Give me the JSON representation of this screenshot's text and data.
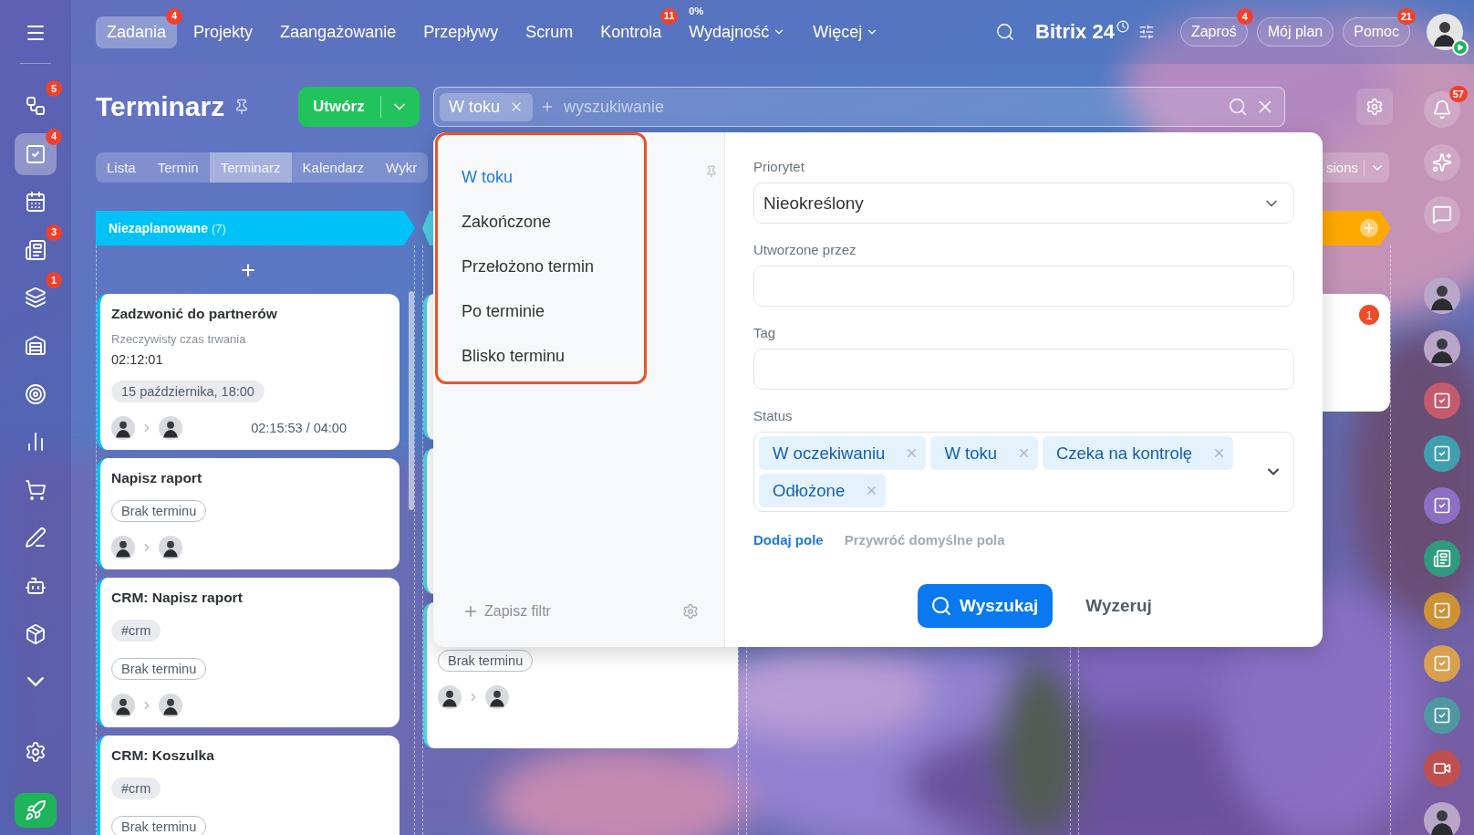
{
  "top_nav": {
    "items": [
      {
        "label": "Zadania",
        "selected": true,
        "badge": "4",
        "dropdown": false
      },
      {
        "label": "Projekty",
        "selected": false,
        "dropdown": false
      },
      {
        "label": "Zaangażowanie",
        "selected": false,
        "dropdown": false
      },
      {
        "label": "Przepływy",
        "selected": false,
        "dropdown": false
      },
      {
        "label": "Scrum",
        "selected": false,
        "dropdown": false
      },
      {
        "label": "Kontrola",
        "selected": false,
        "badge": "11",
        "dropdown": false
      },
      {
        "label": "Wydajność",
        "selected": false,
        "caption": "0%",
        "dropdown": true
      },
      {
        "label": "Więcej",
        "selected": false,
        "dropdown": true
      }
    ],
    "logo": "Bitrix 24",
    "pills": [
      {
        "label": "Zaproś",
        "badge": "4"
      },
      {
        "label": "Mój plan"
      },
      {
        "label": "Pomoc",
        "badge": "21"
      }
    ]
  },
  "sidebar": {
    "items": [
      {
        "selected": false
      },
      {
        "selected": false,
        "badge": "5"
      },
      {
        "selected": true,
        "badge": "4"
      },
      {
        "selected": false
      },
      {
        "selected": false,
        "badge": "3"
      },
      {
        "selected": false,
        "badge": "1"
      },
      {
        "selected": false
      },
      {
        "selected": false
      },
      {
        "selected": false
      },
      {
        "selected": false
      },
      {
        "selected": false
      },
      {
        "selected": false
      },
      {
        "selected": false
      },
      {
        "selected": false
      },
      {
        "selected": false
      },
      {
        "selected": false
      }
    ]
  },
  "header": {
    "title": "Terminarz",
    "create_button": "Utwórz",
    "search": {
      "chips": [
        "W toku"
      ],
      "placeholder": "wyszukiwanie"
    }
  },
  "view_tabs": {
    "items": [
      {
        "label": "Lista",
        "selected": false
      },
      {
        "label": "Termin",
        "selected": false
      },
      {
        "label": "Terminarz",
        "selected": true
      },
      {
        "label": "Kalendarz",
        "selected": false
      },
      {
        "label": "Wykr",
        "selected": false
      }
    ],
    "right_tab": "sions"
  },
  "columns": [
    {
      "kind": "stage",
      "title": "Niezaplanowane",
      "count": "(7)",
      "color": "#00c2f7",
      "cards": [
        {
          "title": "Zadzwonić do partnerów",
          "subtitle": "Rzeczywisty czas trwania",
          "time": "02:12:01",
          "tags": [
            {
              "text": "15 października, 18:00",
              "kind": "date"
            }
          ],
          "avatars": true,
          "elapsed": "02:15:53 / 04:00"
        },
        {
          "title": "Napisz raport",
          "tags": [
            {
              "text": "Brak terminu",
              "kind": "deadline"
            }
          ],
          "avatars": true
        },
        {
          "title": "CRM: Napisz raport",
          "tags": [
            {
              "text": "#crm",
              "kind": "hashtag"
            },
            {
              "text": "Brak terminu",
              "kind": "deadline"
            }
          ],
          "avatars": true
        },
        {
          "title": "CRM: Koszulka",
          "tags": [
            {
              "text": "#crm",
              "kind": "hashtag"
            },
            {
              "text": "Brak terminu",
              "kind": "deadline"
            }
          ],
          "avatars": false
        }
      ]
    },
    {
      "kind": "stage",
      "color": "#4fd0e4",
      "cards": [
        {
          "avatars": false
        },
        {
          "avatars": false
        },
        {
          "tags": [
            {
              "text": "Brak terminu",
              "kind": "deadline"
            }
          ],
          "avatars": true
        }
      ]
    },
    {
      "kind": "empty"
    },
    {
      "kind": "stage",
      "color": "#ffa900",
      "cards": [
        {
          "badge": "1"
        }
      ]
    }
  ],
  "filter_popup": {
    "presets": [
      {
        "label": "W toku",
        "selected": true
      },
      {
        "label": "Zakończone",
        "selected": false
      },
      {
        "label": "Przełożono termin",
        "selected": false
      },
      {
        "label": "Po terminie",
        "selected": false
      },
      {
        "label": "Blisko terminu",
        "selected": false
      }
    ],
    "save_filter": "Zapisz filtr",
    "fields": [
      {
        "label": "Priorytet",
        "kind": "select",
        "value": "Nieokreślony"
      },
      {
        "label": "Utworzone przez",
        "kind": "text"
      },
      {
        "label": "Tag",
        "kind": "text"
      },
      {
        "label": "Status",
        "kind": "multiselect",
        "chips": [
          "W oczekiwaniu",
          "W toku",
          "Czeka na kontrolę",
          "Odłożone"
        ]
      }
    ],
    "add_field": "Dodaj pole",
    "restore_fields": "Przywróć domyślne pola",
    "search_button": "Wyszukaj",
    "reset_button": "Wyzeruj"
  },
  "right_bar": {
    "items": [
      {
        "kind": "tool",
        "badge": "57"
      },
      {
        "kind": "tool"
      },
      {
        "kind": "tool"
      },
      {
        "kind": "avatar"
      },
      {
        "kind": "avatar"
      },
      {
        "kind": "app",
        "color": "#c45a6e"
      },
      {
        "kind": "app",
        "color": "#3f9fae"
      },
      {
        "kind": "app",
        "color": "#8c6fc4"
      },
      {
        "kind": "app",
        "color": "#2f9a7e"
      },
      {
        "kind": "app",
        "color": "#cf9232"
      },
      {
        "kind": "app",
        "color": "#d9a050"
      },
      {
        "kind": "app",
        "color": "#4f98a2"
      },
      {
        "kind": "app",
        "color": "#c05050"
      },
      {
        "kind": "avatar"
      }
    ]
  }
}
